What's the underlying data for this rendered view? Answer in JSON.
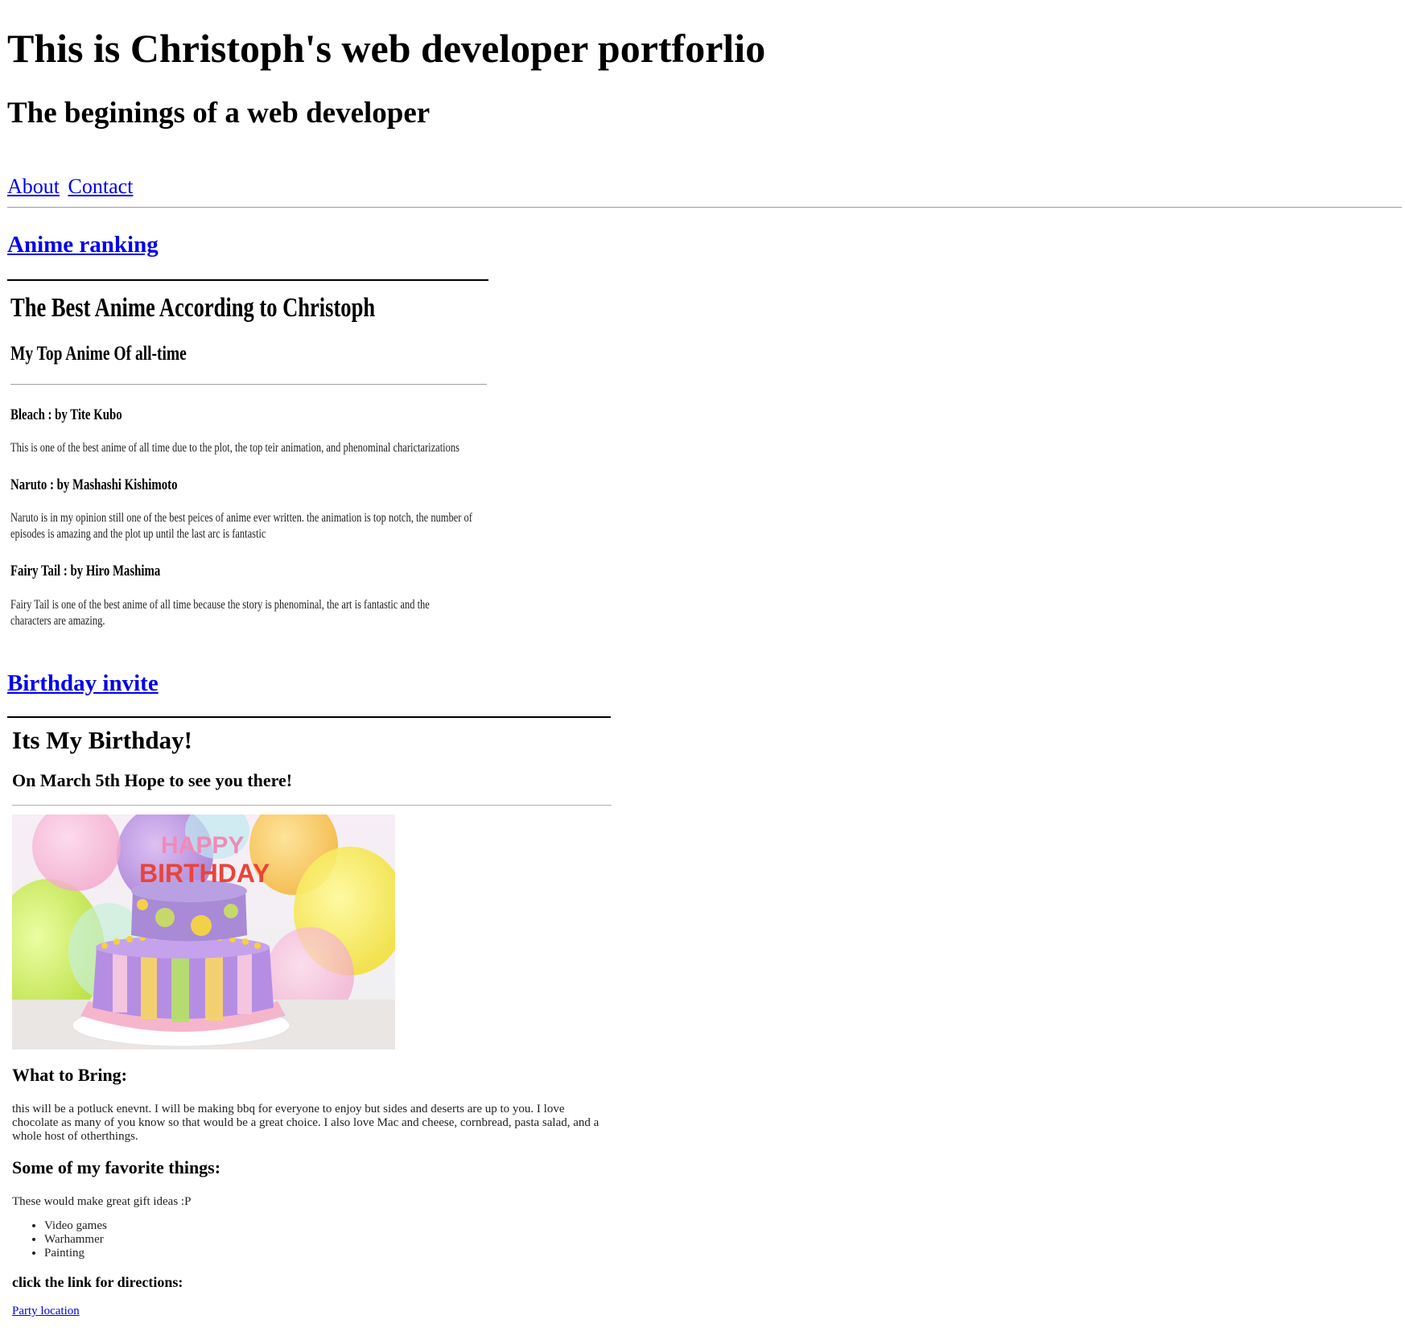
{
  "header": {
    "title": "This is Christoph's web developer portforlio",
    "subtitle": "The beginings of a web developer"
  },
  "nav": {
    "about": "About",
    "contact": "Contact"
  },
  "anime_section": {
    "link_label": "Anime ranking",
    "heading": "The Best Anime According to Christoph",
    "subheading": "My Top Anime Of all-time",
    "items": [
      {
        "title": "Bleach : by Tite Kubo",
        "description": "This is one of the best anime of all time due to the plot, the top teir animation, and phenominal charictarizations"
      },
      {
        "title": "Naruto : by Mashashi Kishimoto",
        "description": "Naruto is in my opinion still one of the best peices of anime ever written. the animation is top notch, the number of episodes is amazing and the plot up until the last arc is fantastic"
      },
      {
        "title": "Fairy Tail : by Hiro Mashima",
        "description": "Fairy Tail is one of the best anime of all time because the story is phenominal, the art is fantastic and the characters are amazing."
      }
    ]
  },
  "birthday_section": {
    "link_label": "Birthday invite",
    "heading": "Its My Birthday!",
    "subheading": "On March 5th Hope to see you there!",
    "image_text_line1": "HAPPY",
    "image_text_line2": "BIRTHDAY",
    "bring_heading": "What to Bring:",
    "bring_text": "this will be a potluck enevnt. I will be making bbq for everyone to enjoy but sides and deserts are up to you. I love chocolate as many of you know so that would be a great choice. I also love Mac and cheese, cornbread, pasta salad, and a whole host of otherthings.",
    "favorites_heading": "Some of my favorite things:",
    "favorites_intro": "These would make great gift ideas :P",
    "favorites": [
      "Video games",
      "Warhammer",
      "Painting"
    ],
    "directions_heading": "click the link for directions:",
    "directions_link": "Party location"
  },
  "colors": {
    "link": "#0000ee",
    "text": "#000000"
  }
}
